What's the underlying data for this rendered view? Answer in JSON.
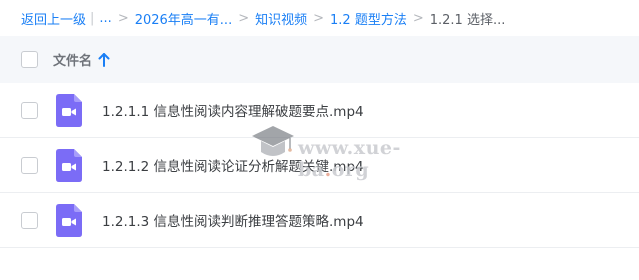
{
  "breadcrumb": {
    "back_label": "返回上一级",
    "ellipsis": "...",
    "items": [
      "2026年高一有...",
      "知识视频",
      "1.2 题型方法"
    ],
    "current": "1.2.1 选择...",
    "separator": ">",
    "pipe": "|"
  },
  "table": {
    "header": {
      "name_label": "文件名",
      "sort": "ascending",
      "sort_icon": "arrow-up-icon"
    },
    "rows": [
      {
        "name": "1.2.1.1 信息性阅读内容理解破题要点.mp4",
        "icon": "video-file-icon"
      },
      {
        "name": "1.2.1.2 信息性阅读论证分析解题关键.mp4",
        "icon": "video-file-icon"
      },
      {
        "name": "1.2.1.3 信息性阅读判断推理答题策略.mp4",
        "icon": "video-file-icon"
      }
    ]
  },
  "watermark": {
    "text_prefix": "www.xue-ba",
    "text_dot": ".",
    "text_suffix": "org"
  },
  "colors": {
    "link": "#1a7ff5",
    "video_icon": "#7b6cf6",
    "header_bg": "#f5f7fa"
  }
}
